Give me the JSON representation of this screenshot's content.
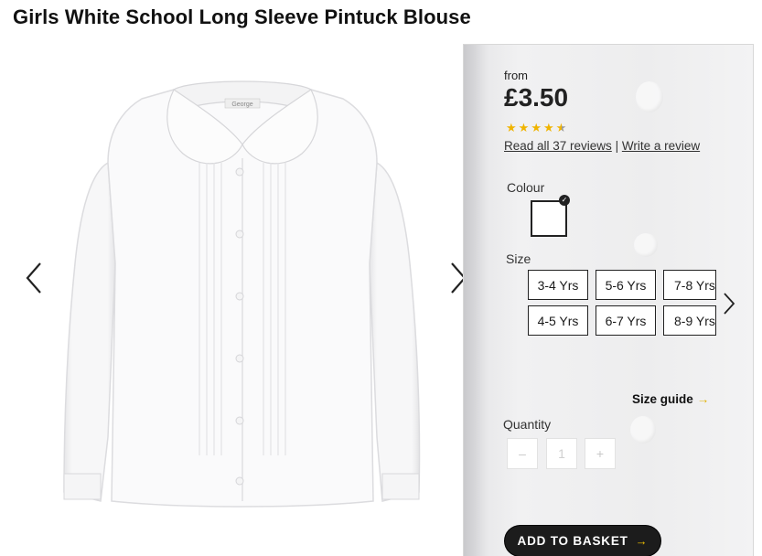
{
  "product": {
    "title": "Girls White School Long Sleeve Pintuck Blouse",
    "price_prefix": "from",
    "price": "£3.50",
    "rating": 4.5,
    "rating_max": 5,
    "reviews_link": "Read all 37 reviews",
    "separator": "|",
    "write_review_link": "Write a review"
  },
  "gallery": {
    "prev_icon": "chevron-left-icon",
    "next_icon": "chevron-right-icon",
    "image_logo_text": "George"
  },
  "colour": {
    "label": "Colour",
    "selected": "white",
    "swatch_color": "#ffffff"
  },
  "size": {
    "label": "Size",
    "options": [
      "3-4 Yrs",
      "5-6 Yrs",
      "7-8 Yrs",
      "4-5 Yrs",
      "6-7 Yrs",
      "8-9 Yrs"
    ],
    "guide_label": "Size guide",
    "guide_arrow": "→"
  },
  "quantity": {
    "label": "Quantity",
    "minus": "–",
    "value": "1",
    "plus": "+"
  },
  "basket": {
    "label": "ADD TO BASKET",
    "arrow": "→"
  },
  "colors": {
    "accent": "#f0b400",
    "button_bg": "#1c1c1c"
  }
}
